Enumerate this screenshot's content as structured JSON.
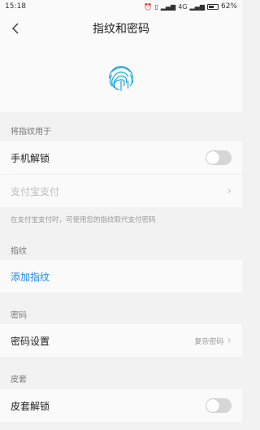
{
  "status_bar": {
    "time": "15:18",
    "network": "4G",
    "battery": "62%",
    "battery_level": 0.62
  },
  "header": {
    "title": "指纹和密码",
    "back_icon": "chevron-left-icon"
  },
  "fingerprint": {
    "icon": "fingerprint-icon",
    "color": "#1fa9d6"
  },
  "sections": {
    "use_for": {
      "header": "将指纹用于",
      "unlock_label": "手机解锁",
      "unlock_enabled": false,
      "alipay_label": "支付宝支付",
      "alipay_note": "在支付宝支付时，可使用您的指纹取代支付密码"
    },
    "fingerprint": {
      "header": "指纹",
      "add_label": "添加指纹"
    },
    "password": {
      "header": "密码",
      "settings_label": "密码设置",
      "settings_value": "复杂密码"
    },
    "cover": {
      "header": "皮套",
      "unlock_label": "皮套解锁",
      "unlock_enabled": false
    }
  },
  "colors": {
    "accent": "#1e88e5",
    "background": "#f2f2f2",
    "card": "#fafafa"
  }
}
